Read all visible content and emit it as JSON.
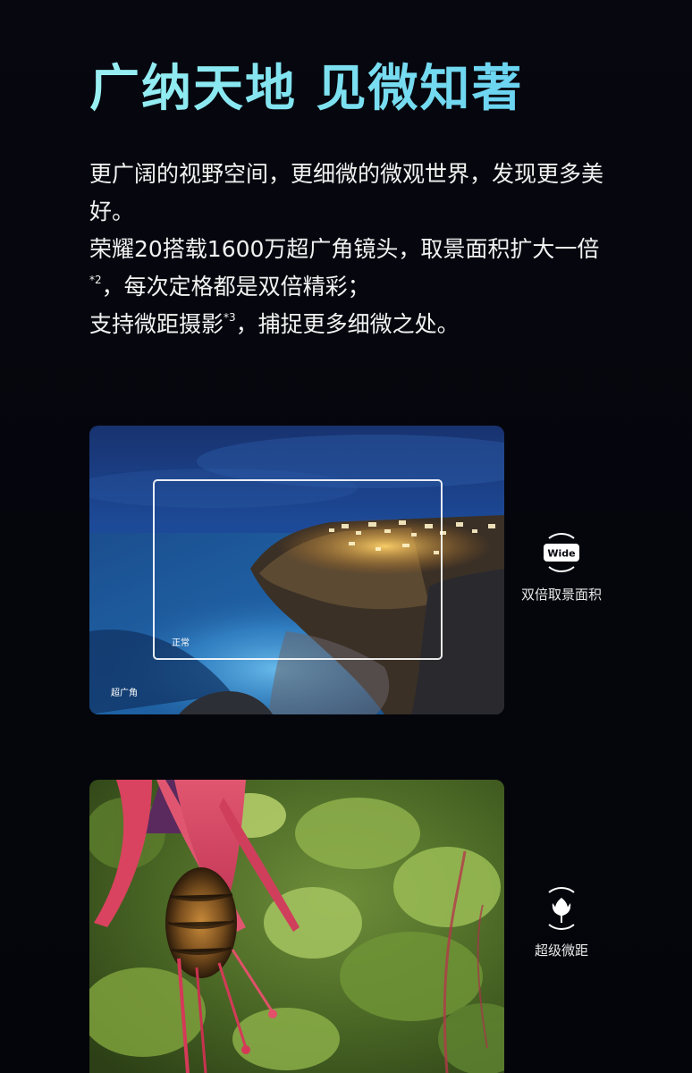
{
  "headline": "广纳天地 见微知著",
  "description": {
    "line1": "更广阔的视野空间，更细微的微观世界，发现更多美好。",
    "line2_before": "荣耀20搭载1600万超广角镜头，取景面积扩大一倍",
    "line2_sup": "*2",
    "line2_after": "，每次定格都是双倍精彩；",
    "line3_before": "支持微距摄影",
    "line3_sup": "*3",
    "line3_after": "，捕捉更多细微之处。"
  },
  "wide_photo": {
    "normal_label": "正常",
    "ultra_wide_label": "超广角"
  },
  "features": {
    "wide": {
      "icon": "wide-badge-icon",
      "icon_text": "Wide",
      "caption": "双倍取景面积"
    },
    "macro": {
      "icon": "tulip-flower-icon",
      "caption": "超级微距"
    }
  },
  "colors": {
    "background": "#05060d",
    "headline_gradient_start": "#9af0f2",
    "headline_gradient_end": "#6ad3f0",
    "text": "#f2f2f2"
  }
}
